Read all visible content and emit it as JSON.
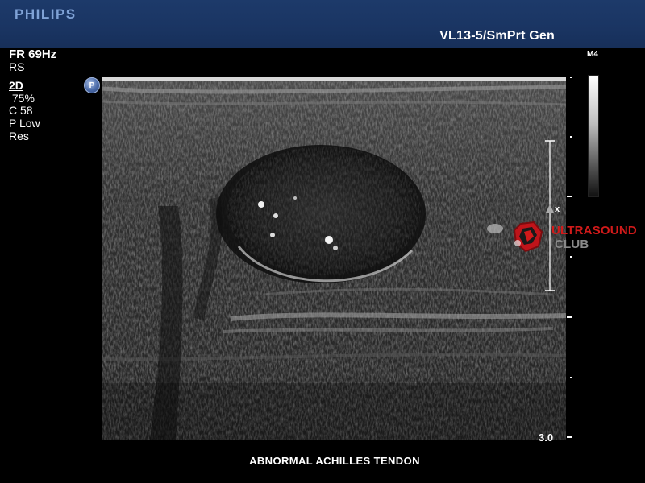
{
  "header": {
    "brand": "PHILIPS",
    "probe_preset": "VL13-5/SmPrt Gen"
  },
  "params": {
    "lines": [
      "FR 69Hz",
      "RS",
      "2D",
      " 75%",
      "C 58",
      "P Low",
      "Res"
    ]
  },
  "pointer_icon": {
    "label": "P"
  },
  "gray_map": {
    "label": "M4"
  },
  "depth": {
    "label": "3.0"
  },
  "focus": {
    "label": "x"
  },
  "watermark": {
    "line1": "ULTRASOUND",
    "line2": "CLUB",
    "accent": "#d21a1a"
  },
  "caption": "ABNORMAL  ACHILLES  TENDON",
  "colors": {
    "header_bg": "#1a3563",
    "brand": "#7fa2d6",
    "background": "#000000"
  }
}
